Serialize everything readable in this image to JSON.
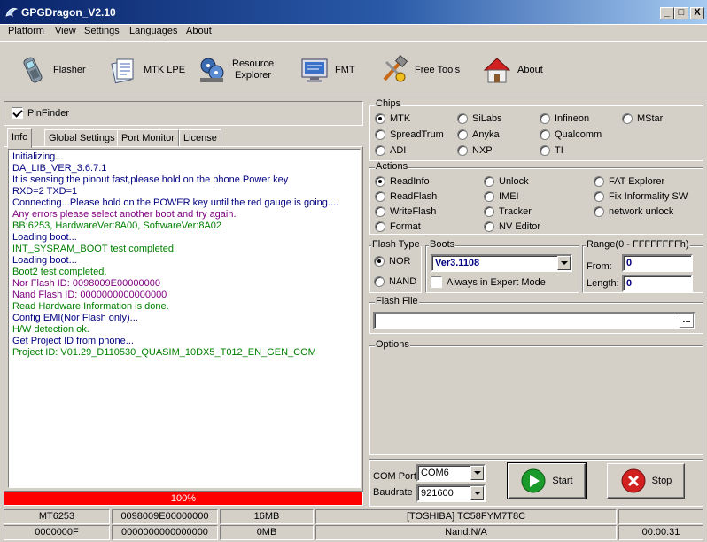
{
  "window": {
    "title": "GPGDragon_V2.10",
    "controls": {
      "minimize": "_",
      "maximize": "□",
      "close": "X"
    }
  },
  "menu": [
    "Platform",
    "View",
    "Settings",
    "Languages",
    "About"
  ],
  "toolbar": [
    {
      "label": "Flasher",
      "icon": "phone-icon"
    },
    {
      "label": "MTK LPE",
      "icon": "document-icon"
    },
    {
      "label": "Resource Explorer",
      "label_line1": "Resource",
      "label_line2": "Explorer",
      "icon": "film-icon"
    },
    {
      "label": "FMT",
      "icon": "monitor-icon"
    },
    {
      "label": "Free Tools",
      "icon": "tools-icon"
    },
    {
      "label": "About",
      "icon": "house-icon"
    }
  ],
  "pinfinder": {
    "label": "PinFinder",
    "checked": true
  },
  "tabs": [
    "Info",
    "Global Settings",
    "Port Monitor",
    "License"
  ],
  "log": [
    {
      "text": "Initializing...",
      "color": "#000080"
    },
    {
      "text": "DA_LIB_VER_3.6.7.1",
      "color": "#000080"
    },
    {
      "text": "It is sensing the pinout fast,please hold on the phone Power key",
      "color": "#000080"
    },
    {
      "text": "RXD=2  TXD=1",
      "color": "#000080"
    },
    {
      "text": "Connecting...Please hold on the POWER key until the red gauge is going....",
      "color": "#000080"
    },
    {
      "text": "Any errors please select another boot and try again.",
      "color": "#800080"
    },
    {
      "text": "BB:6253,    HardwareVer:8A00,    SoftwareVer:8A02",
      "color": "#008000"
    },
    {
      "text": "Loading boot...",
      "color": "#000080"
    },
    {
      "text": "INT_SYSRAM_BOOT test completed.",
      "color": "#008000"
    },
    {
      "text": "Loading boot...",
      "color": "#000080"
    },
    {
      "text": "Boot2 test completed.",
      "color": "#008000"
    },
    {
      "text": "Nor Flash ID: 0098009E00000000",
      "color": "#800080"
    },
    {
      "text": "Nand Flash ID: 0000000000000000",
      "color": "#800080"
    },
    {
      "text": "Read Hardware Information is done.",
      "color": "#008000"
    },
    {
      "text": "Config EMI(Nor Flash only)...",
      "color": "#000080"
    },
    {
      "text": "H/W detection ok.",
      "color": "#008000"
    },
    {
      "text": "Get Project ID from phone...",
      "color": "#000080"
    },
    {
      "text": "Project ID: V01.29_D110530_QUASIM_10DX5_T012_EN_GEN_COM",
      "color": "#008000"
    }
  ],
  "progress": {
    "text": "100%",
    "value": 100,
    "color": "#ff0000"
  },
  "chips": {
    "title": "Chips",
    "options": [
      "MTK",
      "SiLabs",
      "Infineon",
      "MStar",
      "SpreadTrum",
      "Anyka",
      "Qualcomm",
      "ADI",
      "NXP",
      "TI"
    ],
    "selected": "MTK"
  },
  "actions": {
    "title": "Actions",
    "options": [
      "ReadInfo",
      "Unlock",
      "FAT Explorer",
      "ReadFlash",
      "IMEI",
      "Fix Informality SW",
      "WriteFlash",
      "Tracker",
      "network unlock",
      "Format",
      "NV Editor"
    ],
    "selected": "ReadInfo"
  },
  "flash_type": {
    "title": "Flash Type",
    "options": [
      "NOR",
      "NAND"
    ],
    "selected": "NOR"
  },
  "boots": {
    "title": "Boots",
    "value": "Ver3.1108",
    "expert_label": "Always in Expert Mode",
    "expert_checked": false
  },
  "range": {
    "title": "Range(0 - FFFFFFFFh)",
    "from_label": "From:",
    "from_value": "0",
    "length_label": "Length:",
    "length_value": "0"
  },
  "flash_file": {
    "title": "Flash File",
    "value": "",
    "browse_label": "..."
  },
  "options_box": {
    "title": "Options"
  },
  "com": {
    "port_label": "COM Port",
    "port_value": "COM6",
    "baud_label": "Baudrate",
    "baud_value": "921600"
  },
  "buttons": {
    "start": "Start",
    "stop": "Stop"
  },
  "status": {
    "row1": [
      "MT6253",
      "0098009E00000000",
      "16MB",
      "[TOSHIBA] TC58FYM7T8C",
      ""
    ],
    "row2": [
      "0000000F",
      "0000000000000000",
      "0MB",
      "Nand:N/A",
      "00:00:31"
    ]
  }
}
